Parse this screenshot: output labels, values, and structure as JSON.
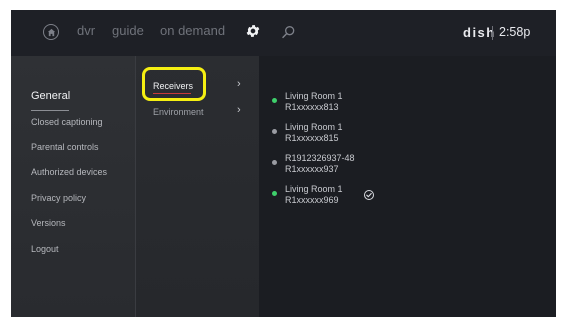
{
  "topbar": {
    "nav": [
      "dvr",
      "guide",
      "on demand"
    ],
    "brand": "dish",
    "time": "2:58p"
  },
  "general_menu": {
    "items": [
      "General",
      "Closed captioning",
      "Parental controls",
      "Authorized devices",
      "Privacy policy",
      "Versions",
      "Logout"
    ],
    "active_index": 0
  },
  "sub_menu": {
    "items": [
      "Receivers",
      "Environment"
    ],
    "active_index": 0
  },
  "receivers": [
    {
      "name": "Living Room 1",
      "id": "R1xxxxxx813",
      "status": "online",
      "selected": false
    },
    {
      "name": "Living Room 1",
      "id": "R1xxxxxx815",
      "status": "offline",
      "selected": false
    },
    {
      "name": "R1912326937-48",
      "id": "R1xxxxxx937",
      "status": "offline",
      "selected": false
    },
    {
      "name": "Living Room 1",
      "id": "R1xxxxxx969",
      "status": "online",
      "selected": true
    }
  ],
  "colors": {
    "online": "#3ecf6b",
    "offline": "#9a9ca3",
    "highlight": "#f5ef12"
  },
  "icons": [
    "home-icon",
    "gear-icon",
    "search-icon",
    "chevron-right-icon",
    "check-circle-icon"
  ]
}
